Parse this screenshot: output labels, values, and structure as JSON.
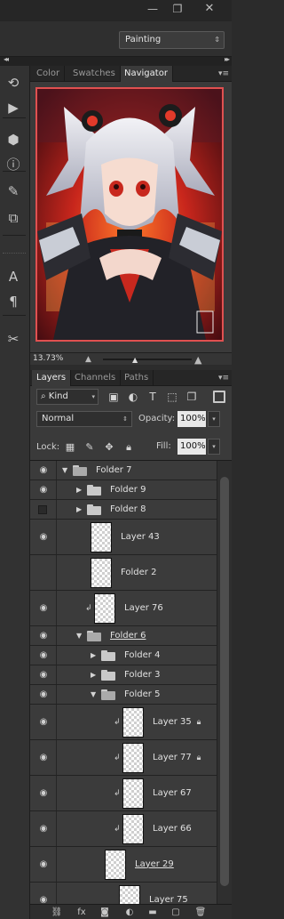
{
  "window_controls": {
    "minimize": "—",
    "restore": "❐",
    "close": "✕"
  },
  "workspace": {
    "value": "Painting"
  },
  "toolstrip": {
    "tools": [
      {
        "icon": "history-icon",
        "glyph": "⟲"
      },
      {
        "icon": "actions-play-icon",
        "glyph": "▶"
      },
      {
        "icon": "3d-icon",
        "glyph": "⬢"
      },
      {
        "icon": "info-icon",
        "glyph": "ⓘ"
      },
      {
        "icon": "brush-presets-icon",
        "glyph": "✎"
      },
      {
        "icon": "clone-source-icon",
        "glyph": "⧉"
      },
      {
        "icon": "character-icon",
        "glyph": "A"
      },
      {
        "icon": "paragraph-icon",
        "glyph": "¶"
      },
      {
        "icon": "tool-presets-icon",
        "glyph": "✂"
      }
    ]
  },
  "top_tabs": [
    "Color",
    "Swatches",
    "Navigator"
  ],
  "top_active_tab": "Navigator",
  "navigator": {
    "zoom": "13.73%"
  },
  "layers_tabs": [
    "Layers",
    "Channels",
    "Paths"
  ],
  "layers_active_tab": "Layers",
  "filter": {
    "kind": "Kind"
  },
  "blend": {
    "mode": "Normal",
    "opacity_label": "Opacity:",
    "opacity": "100%",
    "fill_label": "Fill:",
    "fill": "100%"
  },
  "lock": {
    "label": "Lock:"
  },
  "layers": [
    {
      "name": "Folder 7",
      "type": "folder",
      "expanded": true,
      "visible": true,
      "underlined": false,
      "clipped": false,
      "locked": false
    },
    {
      "name": "Folder 9",
      "type": "folder",
      "expanded": false,
      "visible": true,
      "underlined": false,
      "clipped": false,
      "locked": false
    },
    {
      "name": "Folder 8",
      "type": "folder",
      "expanded": false,
      "visible": false,
      "underlined": false,
      "clipped": false,
      "locked": false
    },
    {
      "name": "Layer 43",
      "type": "layer",
      "visible": true,
      "underlined": false,
      "clipped": false,
      "locked": false
    },
    {
      "name": "Folder 2",
      "type": "layer",
      "visible": false,
      "underlined": false,
      "clipped": false,
      "locked": false
    },
    {
      "name": "Layer 76",
      "type": "layer",
      "visible": true,
      "underlined": false,
      "clipped": true,
      "locked": false
    },
    {
      "name": "Folder 6",
      "type": "folder",
      "expanded": true,
      "visible": true,
      "underlined": true,
      "clipped": false,
      "locked": false
    },
    {
      "name": "Folder 4",
      "type": "folder",
      "expanded": false,
      "visible": true,
      "underlined": false,
      "clipped": false,
      "locked": false
    },
    {
      "name": "Folder 3",
      "type": "folder",
      "expanded": false,
      "visible": true,
      "underlined": false,
      "clipped": false,
      "locked": false
    },
    {
      "name": "Folder 5",
      "type": "folder",
      "expanded": true,
      "visible": true,
      "underlined": false,
      "clipped": false,
      "locked": false
    },
    {
      "name": "Layer 35",
      "type": "layer",
      "visible": true,
      "underlined": false,
      "clipped": true,
      "locked": true
    },
    {
      "name": "Layer 77",
      "type": "layer",
      "visible": true,
      "underlined": false,
      "clipped": true,
      "locked": true
    },
    {
      "name": "Layer 67",
      "type": "layer",
      "visible": true,
      "underlined": false,
      "clipped": true,
      "locked": false
    },
    {
      "name": "Layer 66",
      "type": "layer",
      "visible": true,
      "underlined": false,
      "clipped": true,
      "locked": false
    },
    {
      "name": "Layer 29",
      "type": "layer",
      "visible": true,
      "underlined": true,
      "clipped": false,
      "locked": false
    },
    {
      "name": "Layer 75",
      "type": "layer",
      "visible": true,
      "underlined": false,
      "clipped": false,
      "locked": false
    }
  ],
  "bottom_bar": [
    {
      "icon": "link-layers-icon",
      "glyph": "⛓"
    },
    {
      "icon": "fx-icon",
      "glyph": "fx"
    },
    {
      "icon": "add-mask-icon",
      "glyph": "◙"
    },
    {
      "icon": "adjustment-layer-icon",
      "glyph": "◐"
    },
    {
      "icon": "new-group-icon",
      "glyph": "▬"
    },
    {
      "icon": "new-layer-icon",
      "glyph": "▢"
    },
    {
      "icon": "delete-layer-icon",
      "glyph": "🗑"
    }
  ],
  "colors": {
    "accent_border": "#e05050",
    "panel_bg": "#3a3a3a",
    "chrome_bg": "#262626"
  }
}
